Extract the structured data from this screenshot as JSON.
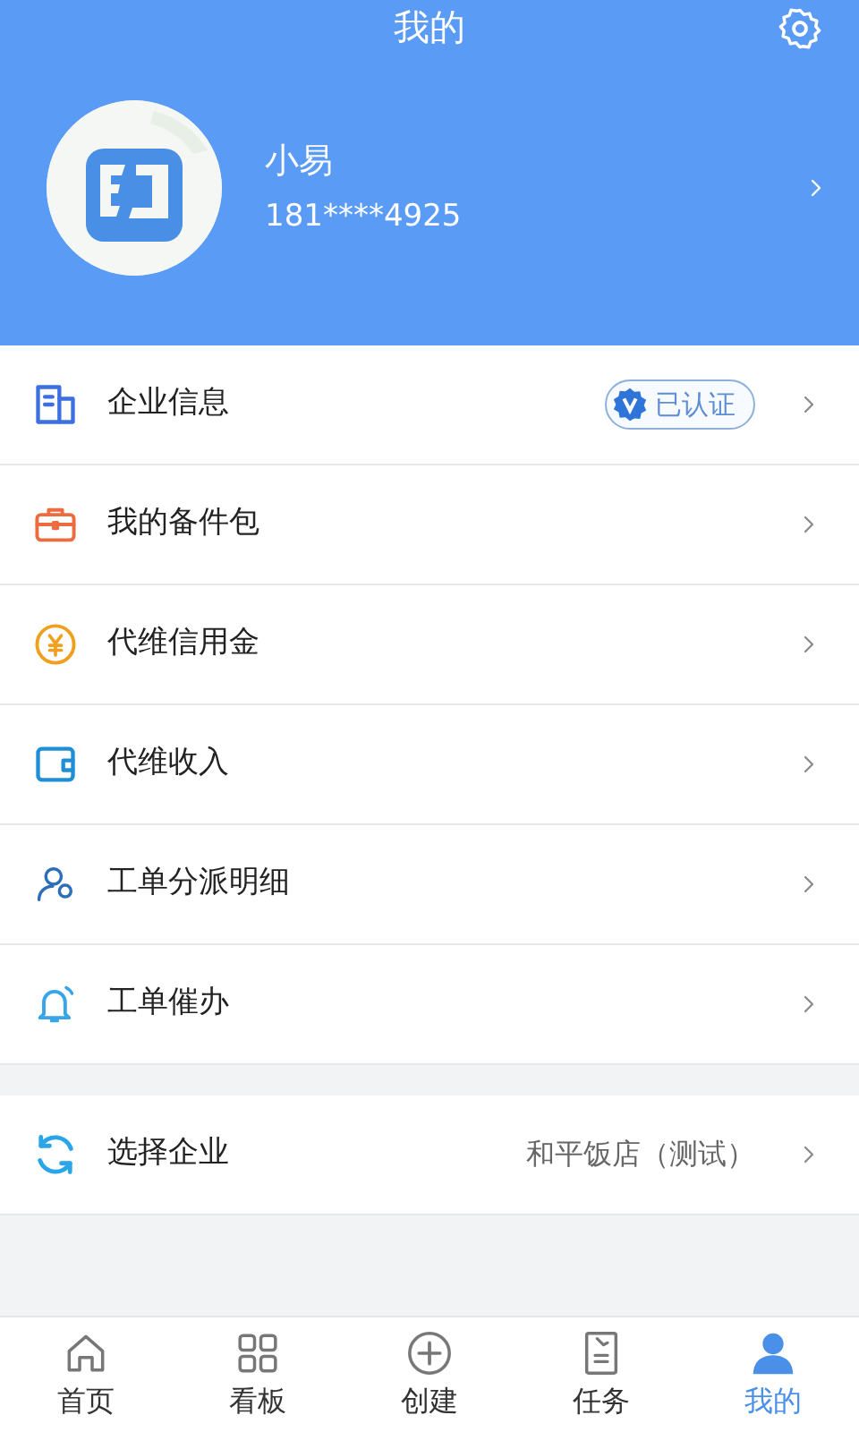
{
  "header": {
    "title": "我的"
  },
  "profile": {
    "name": "小易",
    "phone": "181****4925"
  },
  "menu": [
    {
      "label": "企业信息",
      "badge": "已认证",
      "verified": true
    },
    {
      "label": "我的备件包"
    },
    {
      "label": "代维信用金"
    },
    {
      "label": "代维收入"
    },
    {
      "label": "工单分派明细"
    },
    {
      "label": "工单催办"
    }
  ],
  "company": {
    "label": "选择企业",
    "value": "和平饭店（测试）"
  },
  "tabs": [
    {
      "label": "首页",
      "selected": false
    },
    {
      "label": "看板",
      "selected": false
    },
    {
      "label": "创建",
      "selected": false
    },
    {
      "label": "任务",
      "selected": false
    },
    {
      "label": "我的",
      "selected": true
    }
  ]
}
